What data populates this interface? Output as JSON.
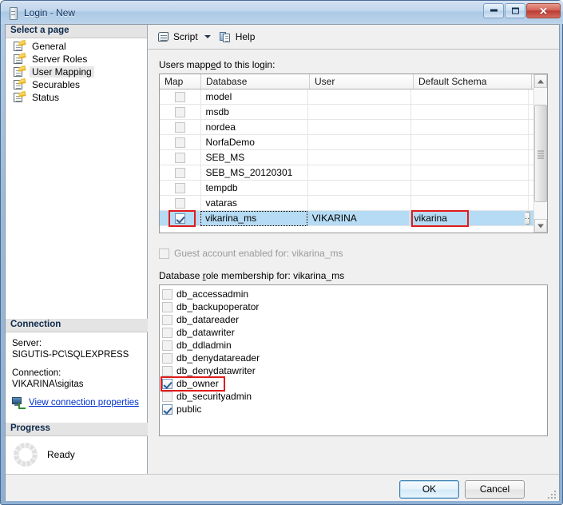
{
  "window": {
    "title": "Login - New",
    "icon": "server-icon",
    "buttons": {
      "minimize": "minimize-icon",
      "maximize": "maximize-icon",
      "close": "✕"
    }
  },
  "sidebar": {
    "select_page_header": "Select a page",
    "pages": [
      {
        "label": "General",
        "selected": false
      },
      {
        "label": "Server Roles",
        "selected": false
      },
      {
        "label": "User Mapping",
        "selected": true
      },
      {
        "label": "Securables",
        "selected": false
      },
      {
        "label": "Status",
        "selected": false
      }
    ],
    "connection": {
      "header": "Connection",
      "server_label": "Server:",
      "server_value": "SIGUTIS-PC\\SQLEXPRESS",
      "connection_label": "Connection:",
      "connection_value": "VIKARINA\\sigitas",
      "view_properties_link": "View connection properties"
    },
    "progress": {
      "header": "Progress",
      "status": "Ready"
    }
  },
  "toolbar": {
    "script_label": "Script",
    "help_label": "Help"
  },
  "main": {
    "users_mapped_label": "Users mapped to this login:",
    "grid": {
      "columns": [
        "Map",
        "Database",
        "User",
        "Default Schema"
      ],
      "rows": [
        {
          "map": false,
          "database": "model",
          "user": "",
          "schema": "",
          "selected": false
        },
        {
          "map": false,
          "database": "msdb",
          "user": "",
          "schema": "",
          "selected": false
        },
        {
          "map": false,
          "database": "nordea",
          "user": "",
          "schema": "",
          "selected": false
        },
        {
          "map": false,
          "database": "NorfaDemo",
          "user": "",
          "schema": "",
          "selected": false
        },
        {
          "map": false,
          "database": "SEB_MS",
          "user": "",
          "schema": "",
          "selected": false
        },
        {
          "map": false,
          "database": "SEB_MS_20120301",
          "user": "",
          "schema": "",
          "selected": false
        },
        {
          "map": false,
          "database": "tempdb",
          "user": "",
          "schema": "",
          "selected": false
        },
        {
          "map": false,
          "database": "vataras",
          "user": "",
          "schema": "",
          "selected": false
        },
        {
          "map": true,
          "database": "vikarina_ms",
          "user": "VIKARINA",
          "schema": "vikarina",
          "selected": true
        }
      ],
      "ellipsis_label": "..."
    },
    "guest_account_label": "Guest account enabled for: vikarina_ms",
    "guest_account_checked": false,
    "guest_account_enabled": false,
    "role_membership_label": "Database role membership for: vikarina_ms",
    "roles": [
      {
        "label": "db_accessadmin",
        "checked": false
      },
      {
        "label": "db_backupoperator",
        "checked": false
      },
      {
        "label": "db_datareader",
        "checked": false
      },
      {
        "label": "db_datawriter",
        "checked": false
      },
      {
        "label": "db_ddladmin",
        "checked": false
      },
      {
        "label": "db_denydatareader",
        "checked": false
      },
      {
        "label": "db_denydatawriter",
        "checked": false
      },
      {
        "label": "db_owner",
        "checked": true
      },
      {
        "label": "db_securityadmin",
        "checked": false
      },
      {
        "label": "public",
        "checked": true
      }
    ]
  },
  "footer": {
    "ok_label": "OK",
    "cancel_label": "Cancel"
  },
  "colors": {
    "selection_row": "#b6dbf4",
    "highlight_box": "#e01b1b",
    "link": "#0033cc",
    "title_text": "#13325c"
  },
  "scrollbar": {
    "position_percent": 22
  }
}
